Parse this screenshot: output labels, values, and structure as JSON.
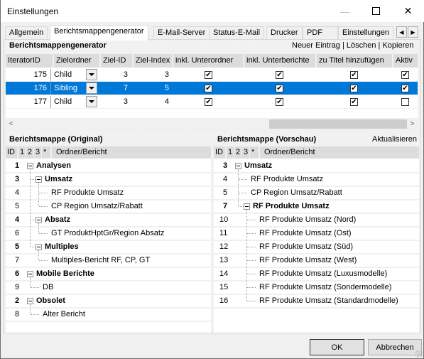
{
  "window": {
    "title": "Einstellungen",
    "minimize_icon": "minimize-icon",
    "maximize_icon": "maximize-icon",
    "close_icon": "close-icon"
  },
  "tabs": [
    {
      "label": "Allgemein",
      "active": false
    },
    {
      "label": "Berichtsmappengenerator",
      "active": true
    },
    {
      "label": "E-Mail-Server",
      "active": false
    },
    {
      "label": "Status-E-Mail",
      "active": false
    },
    {
      "label": "Drucker",
      "active": false
    },
    {
      "label": "PDF",
      "active": false
    },
    {
      "label": "Einstellungen",
      "active": false
    }
  ],
  "tab_scroll": {
    "left": "◀",
    "right": "▶"
  },
  "generator": {
    "title": "Berichtsmappengenerator",
    "actions": {
      "new": "Neuer Eintrag",
      "sep": "|",
      "delete": "Löschen",
      "copy": "Kopieren"
    },
    "columns": [
      "IteratorID",
      "Zielordner",
      "Ziel-ID",
      "Ziel-Index",
      "inkl. Unterordner",
      "inkl. Unterberichte",
      "zu Titel hinzufügen",
      "Aktiv"
    ],
    "rows": [
      {
        "iterator_id": "175",
        "zielordner": "Child",
        "ziel_id": "3",
        "ziel_index": "3",
        "inkl_unterordner": true,
        "inkl_unterberichte": true,
        "zu_titel": true,
        "aktiv": true,
        "selected": false
      },
      {
        "iterator_id": "176",
        "zielordner": "Sibling",
        "ziel_id": "7",
        "ziel_index": "5",
        "inkl_unterordner": true,
        "inkl_unterberichte": true,
        "zu_titel": true,
        "aktiv": true,
        "selected": true
      },
      {
        "iterator_id": "177",
        "zielordner": "Child",
        "ziel_id": "3",
        "ziel_index": "4",
        "inkl_unterordner": true,
        "inkl_unterberichte": true,
        "zu_titel": true,
        "aktiv": false,
        "selected": false
      }
    ],
    "scroll": {
      "left": "<",
      "right": ">"
    }
  },
  "original": {
    "title": "Berichtsmappe (Original)",
    "columns": [
      "ID",
      "1",
      "2",
      "3",
      "*",
      "Ordner/Bericht"
    ],
    "rows": [
      {
        "id": "1",
        "label": "Analysen",
        "level": 0,
        "folder": true
      },
      {
        "id": "3",
        "label": "Umsatz",
        "level": 1,
        "folder": true
      },
      {
        "id": "4",
        "label": "RF Produkte Umsatz",
        "level": 2,
        "folder": false
      },
      {
        "id": "5",
        "label": "CP Region Umsatz/Rabatt",
        "level": 2,
        "folder": false
      },
      {
        "id": "4",
        "label": "Absatz",
        "level": 1,
        "folder": true
      },
      {
        "id": "6",
        "label": "GT ProduktHptGr/Region Absatz",
        "level": 2,
        "folder": false
      },
      {
        "id": "5",
        "label": "Multiples",
        "level": 1,
        "folder": true
      },
      {
        "id": "7",
        "label": "Multiples-Bericht RF, CP, GT",
        "level": 2,
        "folder": false
      },
      {
        "id": "6",
        "label": "Mobile Berichte",
        "level": 0,
        "folder": true
      },
      {
        "id": "9",
        "label": "DB",
        "level": 1,
        "folder": false
      },
      {
        "id": "2",
        "label": "Obsolet",
        "level": 0,
        "folder": true
      },
      {
        "id": "8",
        "label": "Alter Bericht",
        "level": 1,
        "folder": false
      }
    ]
  },
  "preview": {
    "title": "Berichtsmappe (Vorschau)",
    "refresh": "Aktualisieren",
    "columns": [
      "ID",
      "1",
      "2",
      "3",
      "*",
      "Ordner/Bericht"
    ],
    "rows": [
      {
        "id": "3",
        "label": "Umsatz",
        "level": 0,
        "folder": true
      },
      {
        "id": "4",
        "label": "RF Produkte Umsatz",
        "level": 1,
        "folder": false
      },
      {
        "id": "5",
        "label": "CP Region Umsatz/Rabatt",
        "level": 1,
        "folder": false
      },
      {
        "id": "7",
        "label": "RF Produkte Umsatz",
        "level": 1,
        "folder": true
      },
      {
        "id": "10",
        "label": "RF Produkte Umsatz (Nord)",
        "level": 2,
        "folder": false
      },
      {
        "id": "11",
        "label": "RF Produkte Umsatz (Ost)",
        "level": 2,
        "folder": false
      },
      {
        "id": "12",
        "label": "RF Produkte Umsatz (Süd)",
        "level": 2,
        "folder": false
      },
      {
        "id": "13",
        "label": "RF Produkte Umsatz (West)",
        "level": 2,
        "folder": false
      },
      {
        "id": "14",
        "label": "RF Produkte Umsatz (Luxusmodelle)",
        "level": 2,
        "folder": false
      },
      {
        "id": "15",
        "label": "RF Produkte Umsatz (Sondermodelle)",
        "level": 2,
        "folder": false
      },
      {
        "id": "16",
        "label": "RF Produkte Umsatz (Standardmodelle)",
        "level": 2,
        "folder": false
      }
    ]
  },
  "footer": {
    "ok": "OK",
    "cancel": "Abbrechen"
  },
  "colors": {
    "selection": "#0078d7",
    "header_bg": "#dcdcdc",
    "window_bg": "#f0f0f0"
  }
}
